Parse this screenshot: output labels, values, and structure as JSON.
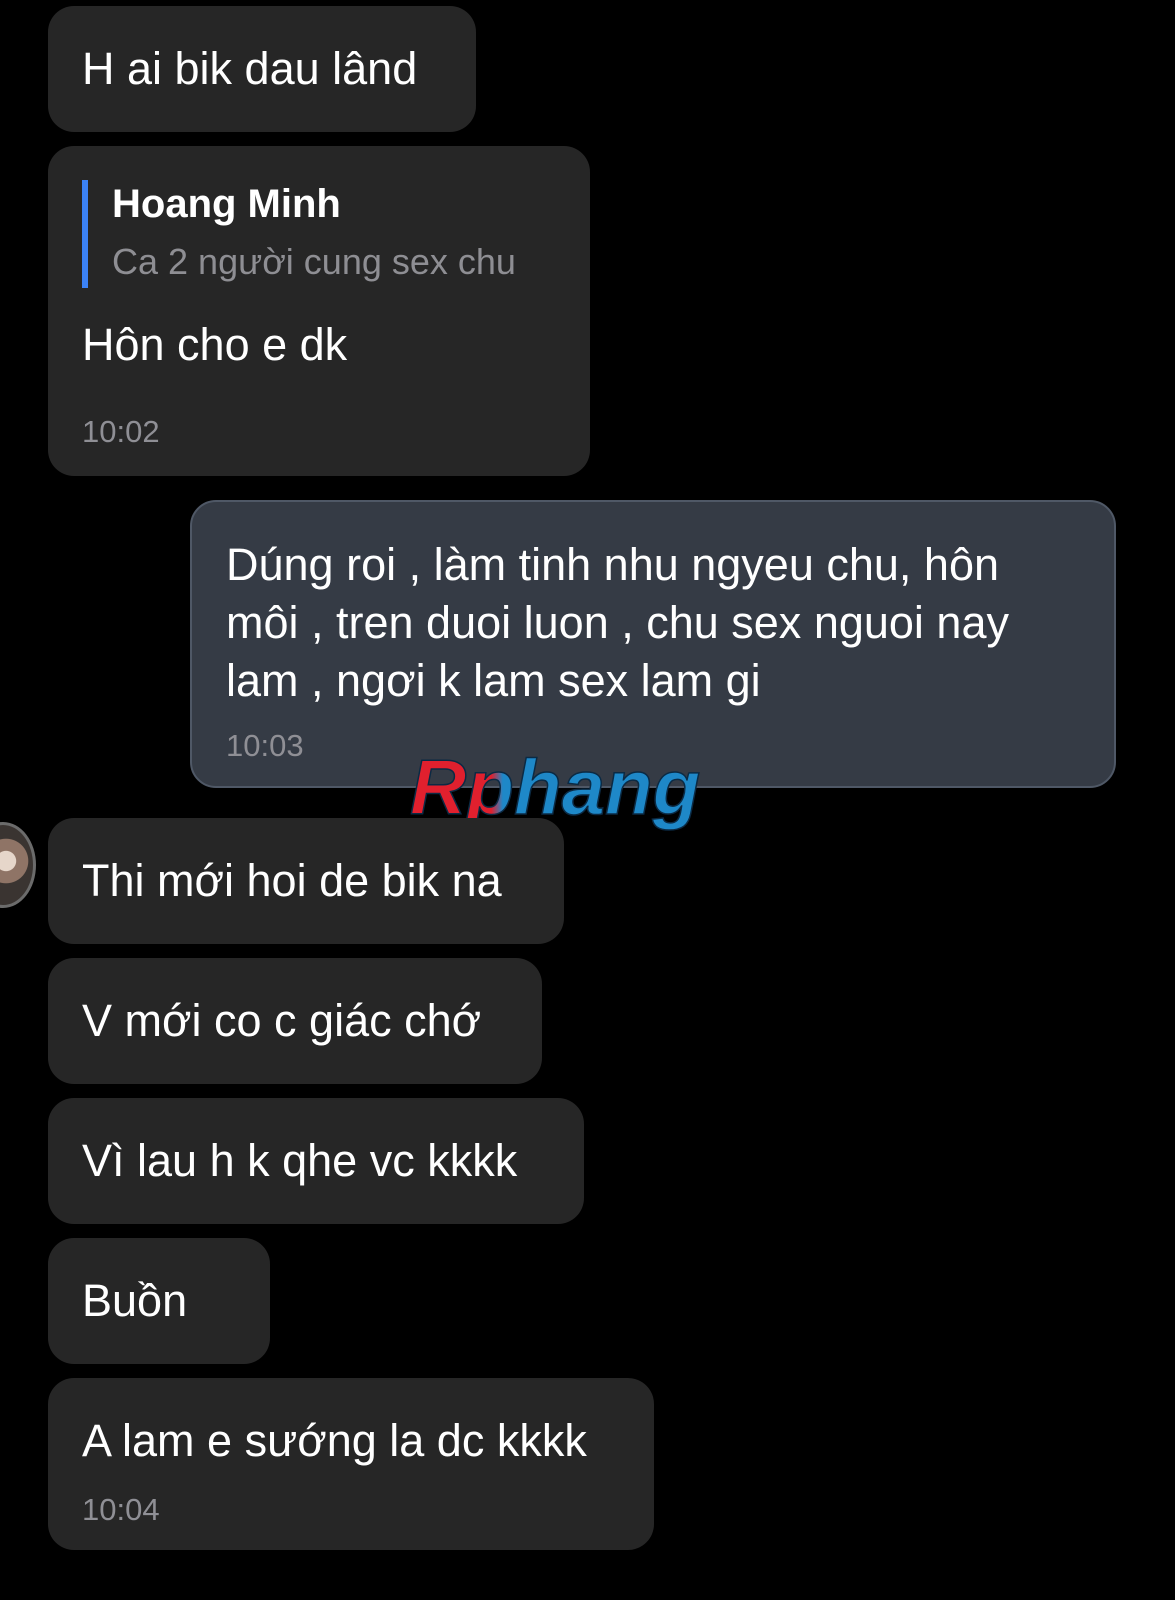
{
  "messages": [
    {
      "text": "H ai bik dau lând"
    },
    {
      "quote": {
        "name": "Hoang Minh",
        "text": "Ca 2 người cung sex chu"
      },
      "text": "Hôn cho e dk",
      "time": "10:02"
    },
    {
      "text": "Dúng roi , làm tinh nhu ngyeu chu, hôn\nmôi , tren duoi luon , chu sex nguoi nay\nlam , ngơi k lam sex lam gi",
      "time": "10:03"
    },
    {
      "text": "Thi mới hoi de bik na"
    },
    {
      "text": "V mới co c giác chớ"
    },
    {
      "text": "Vì lau h k qhe vc kkkk"
    },
    {
      "text": "Buồn"
    },
    {
      "text": "A lam e sướng la dc kkkk",
      "time": "10:04"
    }
  ],
  "watermark": {
    "text": "Rphang",
    "colors": [
      "#e0202e",
      "#1e88c8"
    ]
  },
  "colors": {
    "background": "#000000",
    "incoming": "#262626",
    "outgoing": "#353b45",
    "quote_bar": "#3b82f6"
  }
}
